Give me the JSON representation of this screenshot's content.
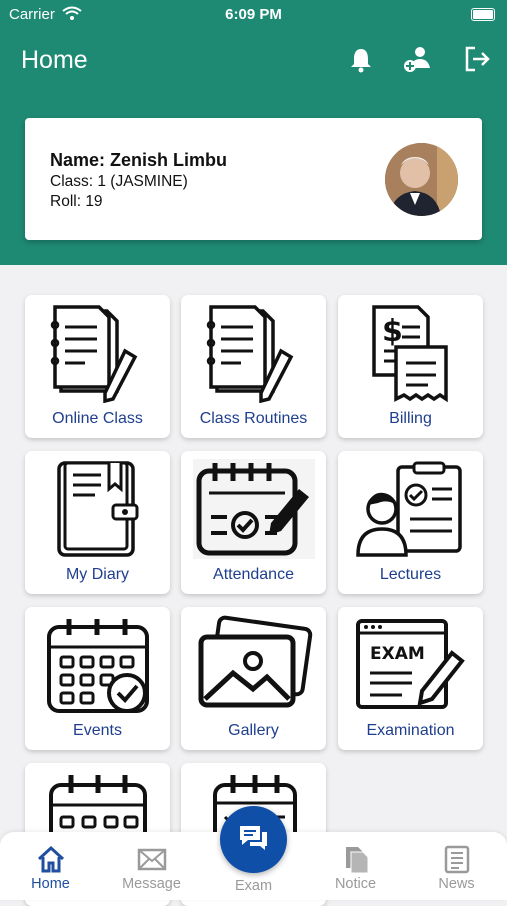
{
  "status_bar": {
    "carrier": "Carrier",
    "time": "6:09 PM"
  },
  "header": {
    "title": "Home"
  },
  "profile": {
    "name": "Name: Zenish Limbu",
    "class": "Class: 1 (JASMINE)",
    "roll": "Roll: 19"
  },
  "tiles": [
    {
      "label": "Online Class",
      "icon": "notebook-pencil-icon"
    },
    {
      "label": "Class Routines",
      "icon": "notebook-pencil-icon"
    },
    {
      "label": "Billing",
      "icon": "invoice-receipt-icon"
    },
    {
      "label": "My Diary",
      "icon": "diary-icon"
    },
    {
      "label": "Attendance",
      "icon": "attendance-calendar-check-icon"
    },
    {
      "label": "Lectures",
      "icon": "lecturer-clipboard-icon"
    },
    {
      "label": "Events",
      "icon": "calendar-check-icon"
    },
    {
      "label": "Gallery",
      "icon": "gallery-image-icon"
    },
    {
      "label": "Examination",
      "icon": "exam-paper-pencil-icon"
    }
  ],
  "nav": {
    "home": "Home",
    "message": "Message",
    "exam": "Exam",
    "notice": "Notice",
    "news": "News"
  },
  "colors": {
    "header": "#1f8a74",
    "accent": "#1f4f9e",
    "fab": "#0f4fa8"
  }
}
